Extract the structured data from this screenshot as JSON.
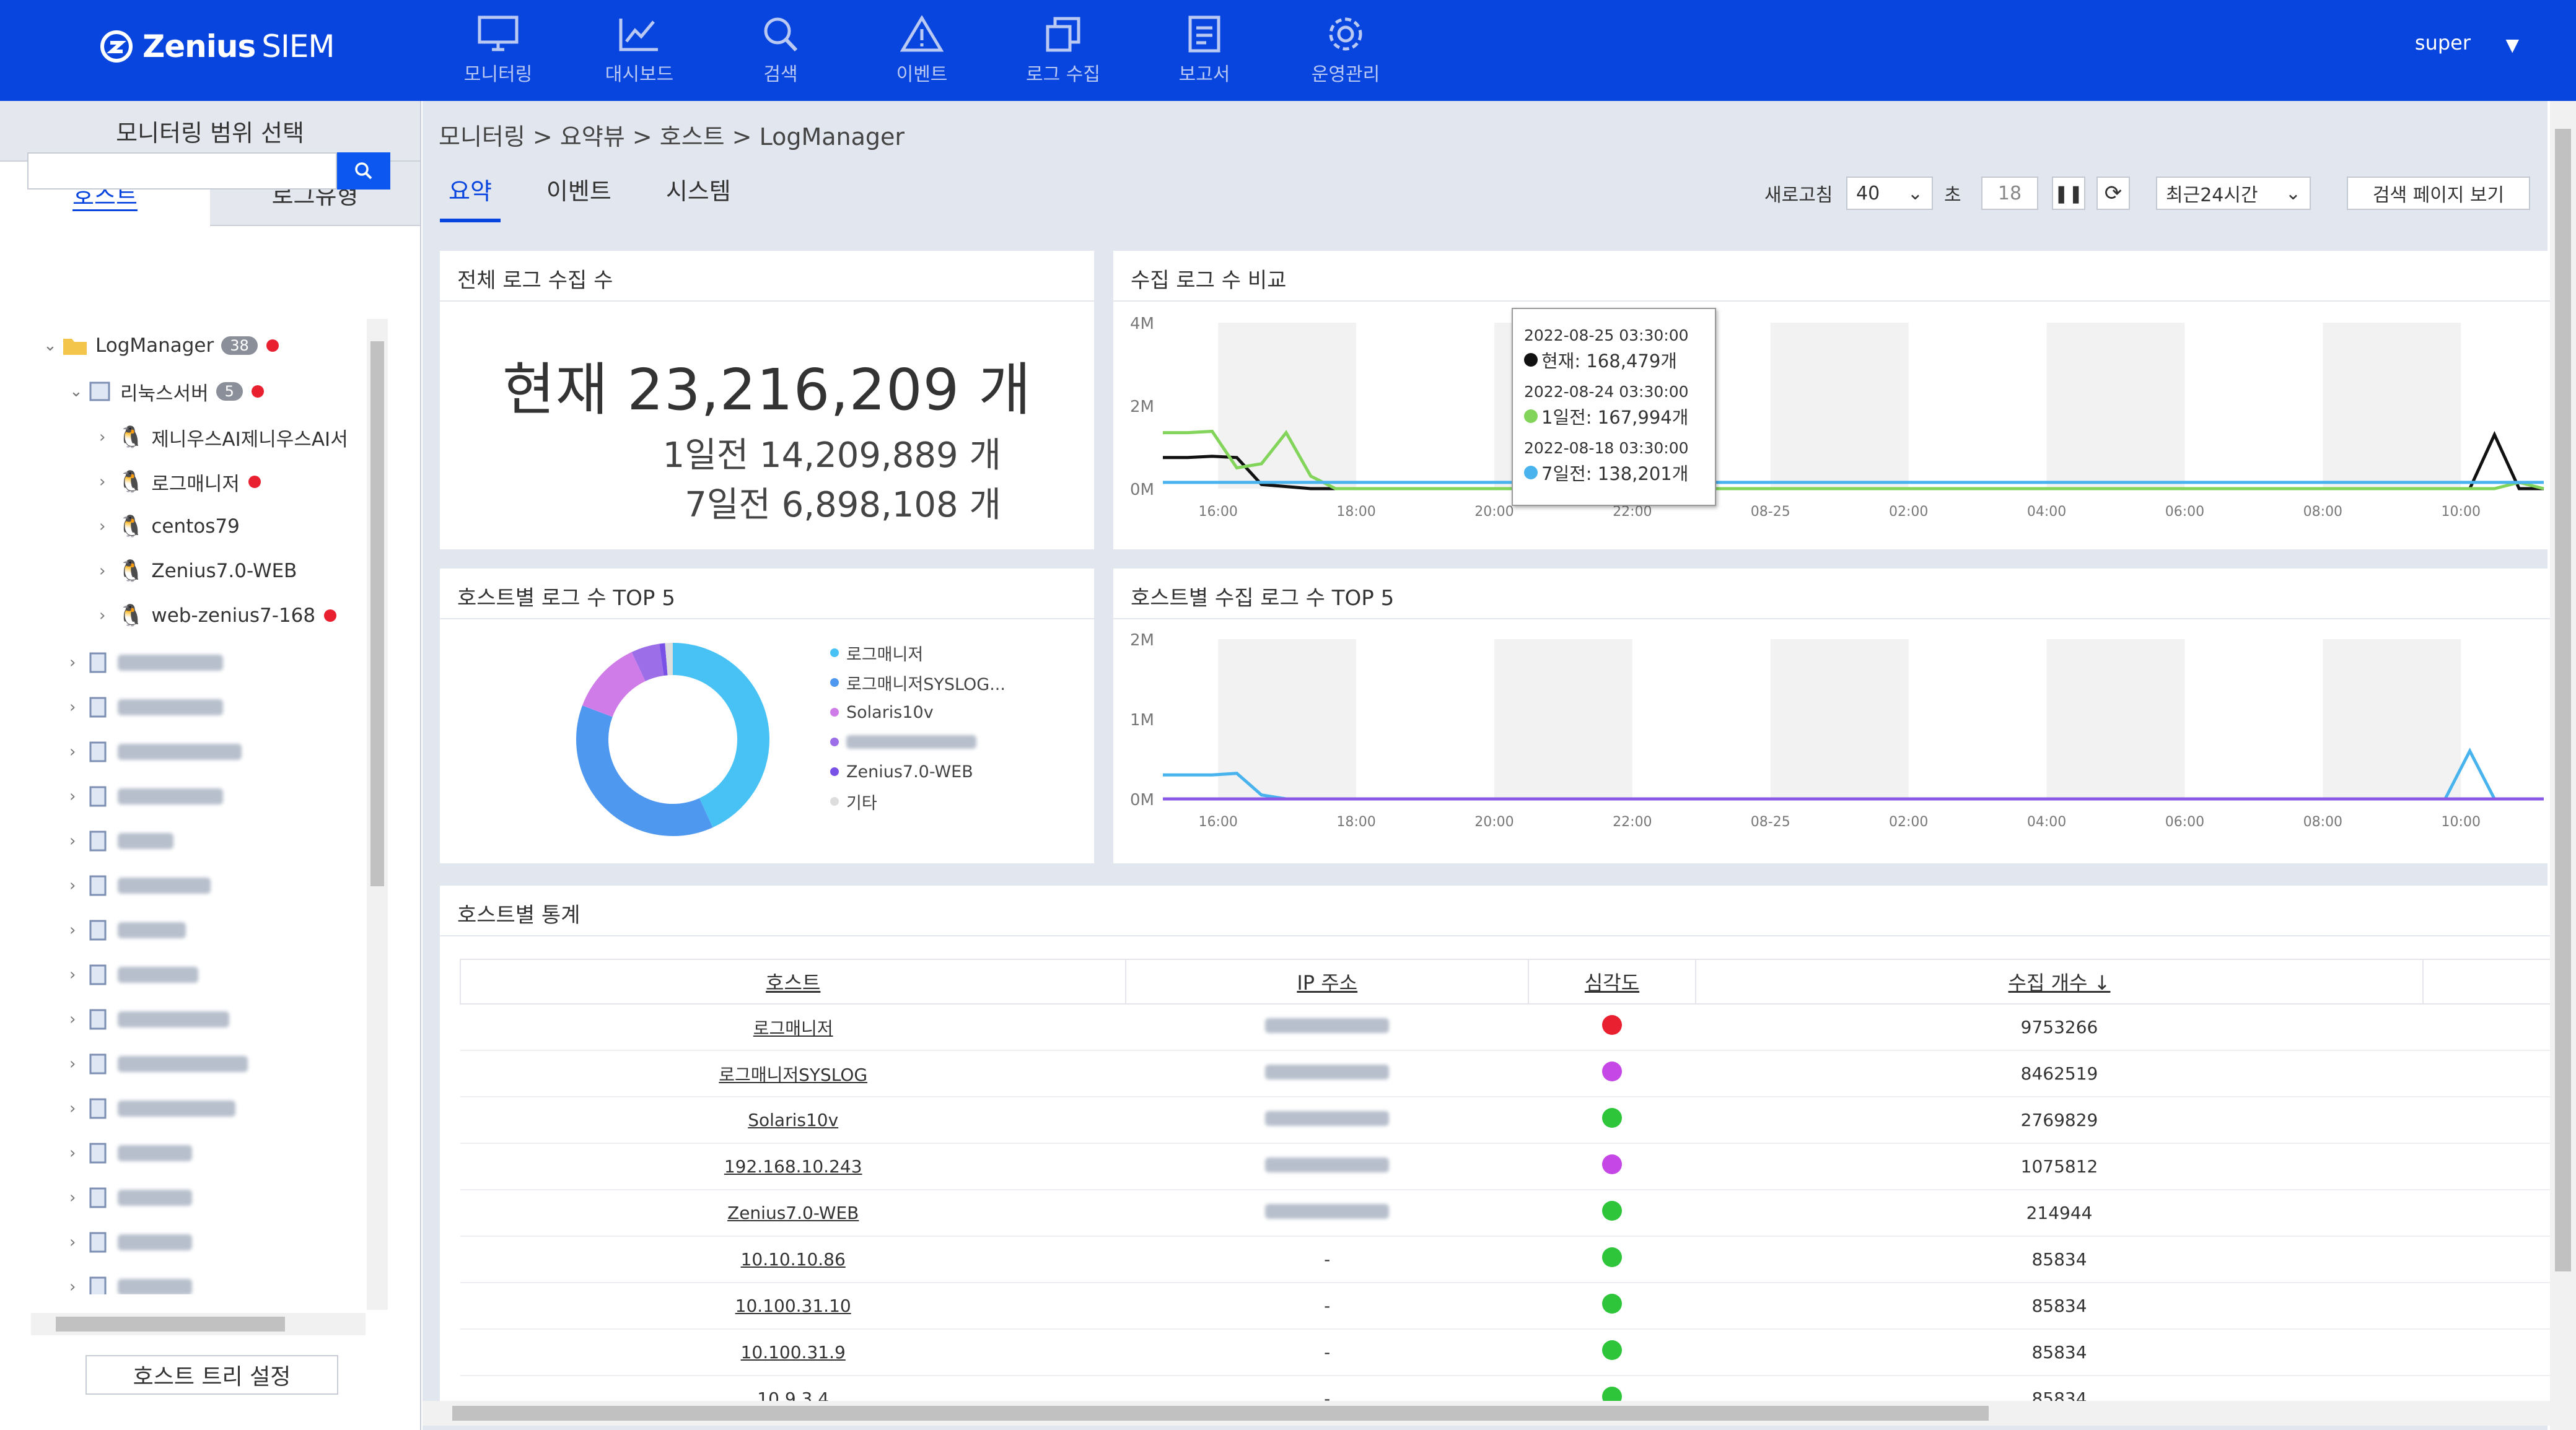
{
  "app": {
    "logo_text": "Zenius",
    "logo_suffix": "SIEM",
    "user": "super"
  },
  "nav": [
    {
      "label": "모니터링",
      "icon": "monitor-icon"
    },
    {
      "label": "대시보드",
      "icon": "dashboard-icon"
    },
    {
      "label": "검색",
      "icon": "search-icon"
    },
    {
      "label": "이벤트",
      "icon": "warning-icon"
    },
    {
      "label": "로그 수집",
      "icon": "copy-icon"
    },
    {
      "label": "보고서",
      "icon": "report-icon"
    },
    {
      "label": "운영관리",
      "icon": "gear-icon"
    }
  ],
  "sidebar": {
    "title": "모니터링 범위 선택",
    "tabs": [
      "호스트",
      "로그유형"
    ],
    "search_placeholder": "",
    "tree": {
      "root": {
        "label": "LogManager",
        "badge": "38"
      },
      "group": {
        "label": "리눅스서버",
        "badge": "5"
      },
      "children": [
        "제니우스AI제니우스AI서",
        "로그매니저",
        "centos79",
        "Zenius7.0-WEB",
        "web-zenius7-168"
      ]
    },
    "tree_button": "호스트 트리 설정"
  },
  "breadcrumb": "모니터링 > 요약뷰 > 호스트 > LogManager",
  "tabs": [
    "요약",
    "이벤트",
    "시스템"
  ],
  "controls": {
    "refresh_label": "새로고침",
    "refresh_value": "40",
    "sec_label": "초",
    "countdown": "18",
    "range": "최근24시간",
    "search_page": "검색 페이지 보기"
  },
  "total_panel": {
    "title": "전체 로그 수집 수",
    "current": "현재 23,216,209 개",
    "day1": "1일전 14,209,889 개",
    "day7": "7일전 6,898,108 개"
  },
  "compare_panel": {
    "title": "수집 로그 수 비교",
    "chart_data": {
      "type": "line",
      "ylabels": [
        "4M",
        "2M",
        "0M"
      ],
      "xlabels": [
        "16:00",
        "18:00",
        "20:00",
        "22:00",
        "08-25",
        "02:00",
        "04:00",
        "06:00",
        "08:00",
        "10:00"
      ],
      "series": [
        {
          "name": "현재",
          "color": "#111111",
          "values": [
            0.75,
            0.75,
            0.78,
            0.75,
            0.1,
            0.05,
            0,
            0,
            0,
            0,
            0,
            0,
            0,
            0,
            0,
            0,
            0,
            0,
            0,
            0,
            0,
            0,
            0,
            0,
            0,
            0,
            0,
            0,
            0,
            0,
            0,
            0,
            0,
            0,
            0,
            0,
            0,
            0,
            0,
            0,
            0,
            0,
            0,
            0,
            0,
            0,
            0,
            0,
            0,
            0,
            0,
            0,
            0,
            0,
            1.3,
            0,
            0
          ]
        },
        {
          "name": "1일전",
          "color": "#82d45a",
          "values": [
            1.35,
            1.35,
            1.38,
            0.5,
            0.6,
            1.35,
            0.3,
            0,
            0,
            0,
            0,
            0,
            0,
            0,
            0,
            0,
            0,
            0,
            0,
            0,
            0,
            0,
            0,
            0,
            0,
            0,
            0,
            0,
            0,
            0,
            0,
            0,
            0,
            0,
            0,
            0,
            0,
            0,
            0,
            0,
            0,
            0,
            0,
            0,
            0,
            0,
            0,
            0,
            0,
            0,
            0,
            0,
            0,
            0,
            0,
            0.15,
            0
          ]
        },
        {
          "name": "7일전",
          "color": "#49b3ee",
          "values": [
            0.15,
            0.15,
            0.15,
            0.15,
            0.15,
            0.15,
            0.15,
            0.15,
            0.15,
            0.15,
            0.15,
            0.15,
            0.15,
            0.15,
            0.15,
            0.15,
            0.15,
            0.15,
            0.15,
            0.15,
            0.15,
            0.15,
            0.15,
            0.15,
            0.15,
            0.15,
            0.15,
            0.15,
            0.15,
            0.15,
            0.15,
            0.15,
            0.15,
            0.15,
            0.15,
            0.15,
            0.15,
            0.15,
            0.15,
            0.15,
            0.15,
            0.15,
            0.15,
            0.15,
            0.15,
            0.15,
            0.15,
            0.15,
            0.15,
            0.15,
            0.15,
            0.15,
            0.15,
            0.15,
            0.15,
            0.15,
            0.15
          ]
        }
      ]
    },
    "tooltip": [
      {
        "date": "2022-08-25 03:30:00",
        "text": "현재: 168,479개",
        "color": "#111111"
      },
      {
        "date": "2022-08-24 03:30:00",
        "text": "1일전: 167,994개",
        "color": "#82d45a"
      },
      {
        "date": "2022-08-18 03:30:00",
        "text": "7일전: 138,201개",
        "color": "#49b3ee"
      }
    ]
  },
  "host_top5": {
    "title": "호스트별 로그 수 TOP 5",
    "chart_data": {
      "type": "pie",
      "labels": [
        "로그매니저",
        "로그매니저SYSLOG...",
        "Solaris10v",
        "",
        "Zenius7.0-WEB",
        "기타"
      ],
      "values": [
        9753266,
        8462519,
        2769829,
        1075812,
        214944,
        300000
      ],
      "colors": [
        "#48c2f5",
        "#4f98f0",
        "#d07ce8",
        "#9c6fe8",
        "#7a51e6",
        "#dddddd"
      ]
    }
  },
  "host_collect_top5": {
    "title": "호스트별 수집 로그 수 TOP 5",
    "chart_data": {
      "type": "line",
      "ylabels": [
        "2M",
        "1M",
        "0M"
      ],
      "xlabels": [
        "16:00",
        "18:00",
        "20:00",
        "22:00",
        "08-25",
        "02:00",
        "04:00",
        "06:00",
        "08:00",
        "10:00"
      ],
      "series": [
        {
          "name": "",
          "color": "#49b3ee",
          "values": [
            0.3,
            0.3,
            0.3,
            0.32,
            0.05,
            0,
            0,
            0,
            0,
            0,
            0,
            0,
            0,
            0,
            0,
            0,
            0,
            0,
            0,
            0,
            0,
            0,
            0,
            0,
            0,
            0,
            0,
            0,
            0,
            0,
            0,
            0,
            0,
            0,
            0,
            0,
            0,
            0,
            0,
            0,
            0,
            0,
            0,
            0,
            0,
            0,
            0,
            0,
            0,
            0,
            0,
            0,
            0,
            0.6,
            0,
            0,
            0
          ]
        },
        {
          "name": "",
          "color": "#8a5ae6",
          "values": [
            0,
            0,
            0,
            0,
            0,
            0,
            0,
            0,
            0,
            0,
            0,
            0,
            0,
            0,
            0,
            0,
            0,
            0,
            0,
            0,
            0,
            0,
            0,
            0,
            0,
            0,
            0,
            0,
            0,
            0,
            0,
            0,
            0,
            0,
            0,
            0,
            0,
            0,
            0,
            0,
            0,
            0,
            0,
            0,
            0,
            0,
            0,
            0,
            0,
            0,
            0,
            0,
            0,
            0,
            0,
            0,
            0
          ]
        }
      ]
    }
  },
  "stats": {
    "title": "호스트별 통계",
    "headers": [
      "호스트",
      "IP 주소",
      "심각도",
      "수집 개수 ↓"
    ],
    "rows": [
      {
        "host": "로그매니저",
        "ip": "",
        "sev": "#e8202f",
        "count": "9753266"
      },
      {
        "host": "로그매니저SYSLOG",
        "ip": "",
        "sev": "#c548e6",
        "count": "8462519"
      },
      {
        "host": "Solaris10v",
        "ip": "",
        "sev": "#2ec53b",
        "count": "2769829"
      },
      {
        "host": "192.168.10.243",
        "ip": "",
        "sev": "#c548e6",
        "count": "1075812"
      },
      {
        "host": "Zenius7.0-WEB",
        "ip": "",
        "sev": "#2ec53b",
        "count": "214944"
      },
      {
        "host": "10.10.10.86",
        "ip": "-",
        "sev": "#2ec53b",
        "count": "85834"
      },
      {
        "host": "10.100.31.10",
        "ip": "-",
        "sev": "#2ec53b",
        "count": "85834"
      },
      {
        "host": "10.100.31.9",
        "ip": "-",
        "sev": "#2ec53b",
        "count": "85834"
      },
      {
        "host": "10.9.3.4",
        "ip": "-",
        "sev": "#2ec53b",
        "count": "85834"
      }
    ]
  }
}
